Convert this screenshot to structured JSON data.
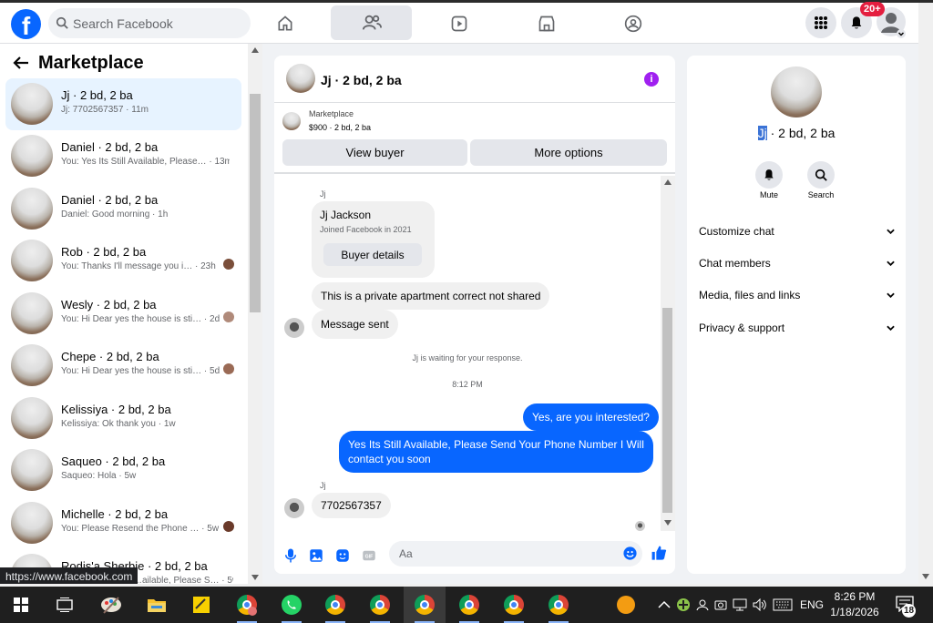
{
  "topbar": {
    "search_placeholder": "Search Facebook",
    "notifications_badge": "20+",
    "logo_letter": "f"
  },
  "sidebar": {
    "title": "Marketplace",
    "conversations": [
      {
        "name": "Jj · 2 bd, 2 ba",
        "preview": "Jj: 7702567357 · 11m",
        "selected": true
      },
      {
        "name": "Daniel · 2 bd, 2 ba",
        "preview": "You: Yes Its Still Available, Please… · 13m"
      },
      {
        "name": "Daniel · 2 bd, 2 ba",
        "preview": "Daniel: Good morning · 1h"
      },
      {
        "name": "Rob · 2 bd, 2 ba",
        "preview": "You: Thanks I'll message you i… · 23h"
      },
      {
        "name": "Wesly · 2 bd, 2 ba",
        "preview": "You: Hi Dear yes the house is sti… · 2d"
      },
      {
        "name": "Chepe · 2 bd, 2 ba",
        "preview": "You: Hi Dear yes the house is sti… · 5d"
      },
      {
        "name": "Kelissiya · 2 bd, 2 ba",
        "preview": "Kelissiya: Ok thank you · 1w"
      },
      {
        "name": "Saqueo · 2 bd, 2 ba",
        "preview": "Saqueo: Hola · 5w"
      },
      {
        "name": "Michelle · 2 bd, 2 ba",
        "preview": "You: Please Resend the Phone … · 5w"
      },
      {
        "name": "Rodis'a Sherbie · 2 bd, 2 ba",
        "preview": "…ailable, Please S… · 5w"
      }
    ],
    "status_url": "https://www.facebook.com"
  },
  "chat": {
    "title": "Jj · 2 bd, 2 ba",
    "info_glyph": "i",
    "listing_label": "Marketplace",
    "listing_price": "$900 · 2 bd, 2 ba",
    "view_buyer": "View buyer",
    "more_options": "More options",
    "sender_name": "Jj",
    "card_name": "Jj Jackson",
    "card_joined": "Joined Facebook in 2021",
    "card_button": "Buyer details",
    "msg1": "This is a private apartment correct not shared",
    "msg2": "Message sent",
    "waiting": "Jj is waiting for your response.",
    "time": "8:12 PM",
    "out1": "Yes, are you interested?",
    "out2": "Yes Its Still Available, Please Send Your Phone Number I Will contact you soon",
    "sender_name2": "Jj",
    "msg3": "7702567357",
    "composer_placeholder": "Aa"
  },
  "rpanel": {
    "name_highlight": "Jj",
    "name_rest": " · 2 bd, 2 ba",
    "mute": "Mute",
    "search": "Search",
    "items": [
      "Customize chat",
      "Chat members",
      "Media, files and links",
      "Privacy & support"
    ]
  },
  "taskbar": {
    "lang": "ENG",
    "time": "8:26 PM",
    "date": "1/18/2026",
    "notif_count": "18"
  },
  "colors": {
    "fb_blue": "#0866ff",
    "badge_red": "#e41e3f",
    "info_purple": "#a020f0"
  }
}
